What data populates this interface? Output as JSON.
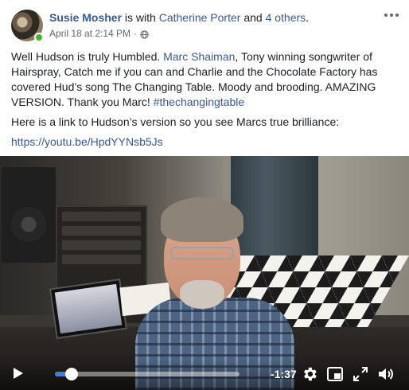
{
  "post": {
    "author": "Susie Mosher",
    "with_text": " is with ",
    "with_name": "Catherine Porter",
    "and_text": " and ",
    "others": "4 others",
    "period": ".",
    "timestamp": "April 18 at 2:14 PM",
    "separator": "·",
    "privacy_icon": "globe-icon",
    "text": {
      "p1_a": "Well Hudson is truly Humbled. ",
      "p1_link": "Marc Shaiman",
      "p1_b": ", Tony winning songwriter of Hairspray, Catch me if you can and Charlie and the Chocolate Factory has covered Hud’s song The Changing Table. Moody and brooding. AMAZING VERSION. Thank you Marc! ",
      "p1_hashtag": "#thechangingtable",
      "p2": "Here is a link to Hudson’s version so you see Marcs true brilliance:",
      "p3_link": "https://youtu.be/HpdYYNsb5Js"
    }
  },
  "video": {
    "progress": 0.09,
    "time_remaining": "-1:37",
    "icons": [
      "play-icon",
      "gear-icon",
      "picture-in-picture-icon",
      "fullscreen-icon",
      "volume-icon"
    ]
  },
  "colors": {
    "link": "#385898",
    "online": "#42b72a",
    "progress": "#4b7bd8"
  }
}
